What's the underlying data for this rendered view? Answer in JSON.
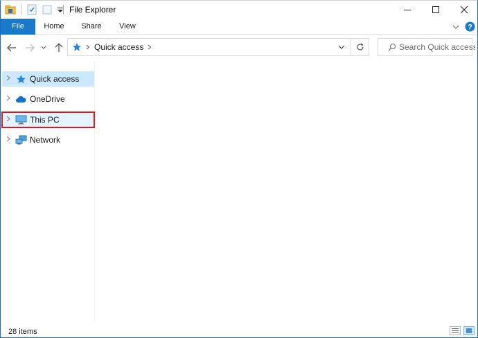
{
  "window": {
    "title": "File Explorer"
  },
  "quick_access_toolbar": {
    "icons": [
      "folder-properties-icon",
      "checkmark-document-icon",
      "new-folder-icon",
      "customize-dropdown-icon"
    ]
  },
  "ribbon": {
    "tabs": [
      {
        "label": "File",
        "active": true
      },
      {
        "label": "Home"
      },
      {
        "label": "Share"
      },
      {
        "label": "View"
      }
    ]
  },
  "navigation": {
    "breadcrumb": "Quick access",
    "search_placeholder": "Search Quick access"
  },
  "nav_pane": {
    "items": [
      {
        "label": "Quick access",
        "icon": "star-icon",
        "selected": true
      },
      {
        "label": "OneDrive",
        "icon": "cloud-icon"
      },
      {
        "label": "This PC",
        "icon": "monitor-icon",
        "highlighted": true
      },
      {
        "label": "Network",
        "icon": "network-icon"
      }
    ]
  },
  "status": {
    "item_count": "28 items"
  },
  "colors": {
    "file_tab": "#1979ca",
    "selection": "#cce8ff",
    "highlight_border": "#e0171f",
    "help": "#1979ca"
  }
}
